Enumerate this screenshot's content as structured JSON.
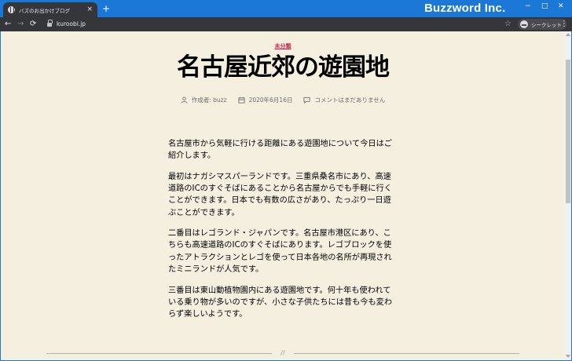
{
  "browser": {
    "tab_title": "バズのお出かけブログ",
    "tab_close": "×",
    "new_tab": "+",
    "brand": "Buzzword Inc.",
    "window_controls": {
      "minimize": "−",
      "maximize": "□",
      "close": "✕"
    },
    "nav": {
      "back": "←",
      "forward": "→",
      "reload": "⟳"
    },
    "url": "kuroobi.jp",
    "bookmark_star": "☆",
    "incognito_label": "シークレット",
    "menu": "⋮"
  },
  "post": {
    "category": "未分類",
    "title": "名古屋近郊の遊園地",
    "meta": {
      "author": "作成者: buzz",
      "date": "2020年6月16日",
      "comments": "コメントはまだありません"
    },
    "paragraphs": [
      "名古屋市から気軽に行ける距離にある遊園地について今日はご紹介します。",
      "最初はナガシマスパーランドです。三重県桑名市にあり、高速道路のICのすぐそばにあることから名古屋からでも手軽に行くことができます。日本でも有数の広さがあり、たっぷり一日遊ぶことができます。",
      "二番目はレゴランド・ジャパンです。名古屋市港区にあり、こちらも高速道路のICのすぐそばにあります。レゴブロックを使ったアトラクションとレゴを使って日本各地の名所が再現されたミニランドが人気です。",
      "三番目は東山動植物園内にある遊園地です。何十年も使われている乗り物が多いのですが、小さな子供たちには昔も今も変わらず楽しいようです。"
    ],
    "separator_mark": "//"
  },
  "colors": {
    "chrome_blue": "#1b78d6",
    "toolbar": "#35363a",
    "page_bg": "#f5efe0",
    "accent": "#cd2653",
    "meta_text": "#6d6d6d"
  }
}
